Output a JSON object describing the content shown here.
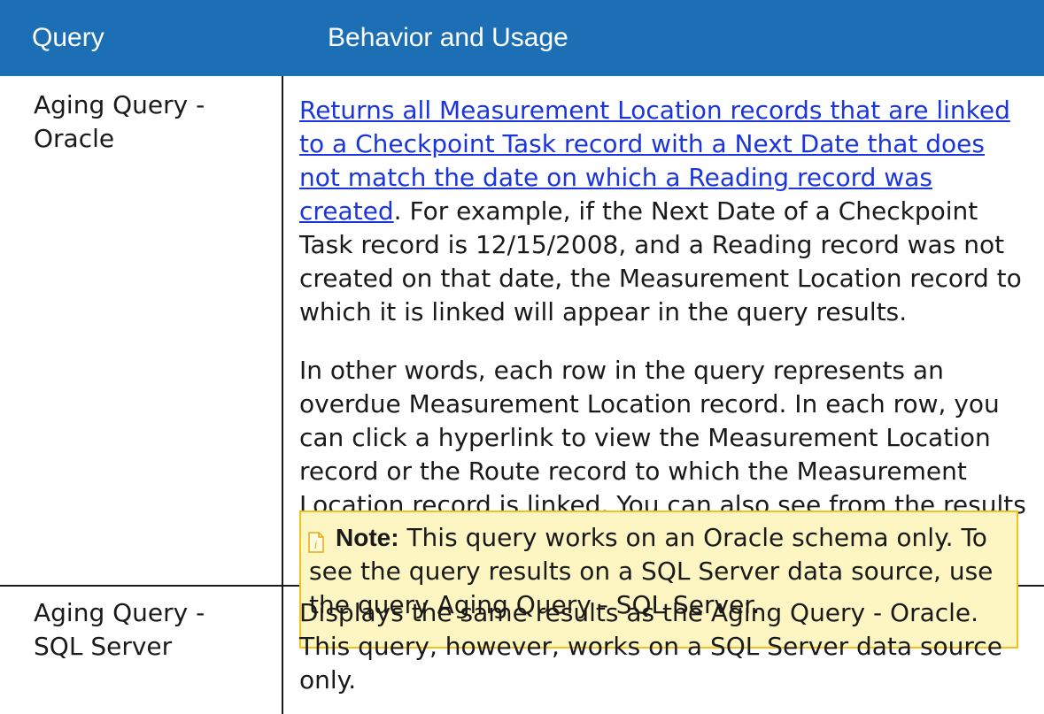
{
  "table": {
    "headers": {
      "query": "Query",
      "behavior": "Behavior and Usage"
    },
    "rows": [
      {
        "query": "Aging Query - Oracle",
        "paragraphs": {
          "p1_link": "Returns all Measurement Location records that are linked to a Checkpoint Task record with a Next Date that does not match the date on which a Reading record was created",
          "p1_rest": ". For example, if the Next Date of a Checkpoint Task record is 12/15/2008, and a Reading record was not created on that date, the Measurement Location record to which it is linked will appear in the query results.",
          "p2": "In other words, each row in the query represents an overdue Measurement Location record. In each row, you can click a hyperlink to view the Measurement Location record or the Route record to which the Measurement Location record is linked. You can also see from the results how many days the Measurement Location record is overdue."
        },
        "note": {
          "label": "Note:",
          "text": " This query works on an Oracle schema only. To see the query results on a SQL Server data source, use the query Aging Query - SQL Server.",
          "icon": "note-document-icon"
        }
      },
      {
        "query": "Aging Query - SQL Server",
        "paragraphs": {
          "p1": "Displays the same results as the Aging Query - Oracle. This query, however, works on a SQL Server data source only."
        }
      }
    ]
  },
  "colors": {
    "header_bg": "#1d6fb5",
    "link": "#1a35e0",
    "note_bg": "#fdf6c3",
    "note_border": "#f2c21b"
  }
}
